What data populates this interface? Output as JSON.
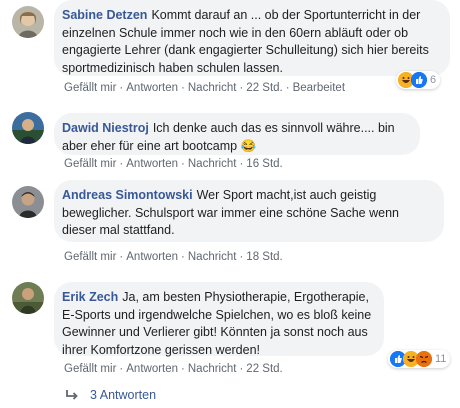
{
  "comments": [
    {
      "author": "Sabine Detzen",
      "text": "Kommt darauf an ... ob der Sportunterricht in der einzelnen Schule immer noch wie in den 60ern abläuft oder ob engagierte Lehrer (dank engagierter Schulleitung) sich hier bereits sportmedizinisch haben schulen lassen.",
      "actions": [
        "Gefällt mir",
        "Antworten",
        "Nachricht"
      ],
      "time": "22 Std.",
      "edited": "Bearbeitet",
      "reaction_count": "6",
      "reaction_icons": [
        "laugh-reaction-icon",
        "like-reaction-icon"
      ]
    },
    {
      "author": "Dawid Niestroj",
      "text": "Ich denke auch das es sinnvoll währe.... bin aber eher für eine art bootcamp 😂",
      "actions": [
        "Gefällt mir",
        "Antworten",
        "Nachricht"
      ],
      "time": "16 Std."
    },
    {
      "author": "Andreas Simontowski",
      "text": "Wer Sport macht,ist auch geistig beweglicher. Schulsport war immer eine schöne Sache wenn dieser mal stattfand.",
      "actions": [
        "Gefällt mir",
        "Antworten",
        "Nachricht"
      ],
      "time": "18 Std."
    },
    {
      "author": "Erik Zech",
      "text": "Ja, am besten Physiotherapie, Ergotherapie, E-Sports und irgendwelche Spielchen, wo es bloß keine Gewinner und Verlierer gibt! Könnten ja sonst noch aus ihrer Komfortzone gerissen werden!",
      "actions": [
        "Gefällt mir",
        "Antworten",
        "Nachricht"
      ],
      "time": "22 Std.",
      "reaction_count": "11",
      "reaction_icons": [
        "like-reaction-icon",
        "laugh-reaction-icon",
        "angry-reaction-icon"
      ]
    }
  ],
  "replies_label": "3 Antworten",
  "colors": {
    "link": "#385898",
    "bubble": "#f2f3f5",
    "meta": "#606770"
  }
}
